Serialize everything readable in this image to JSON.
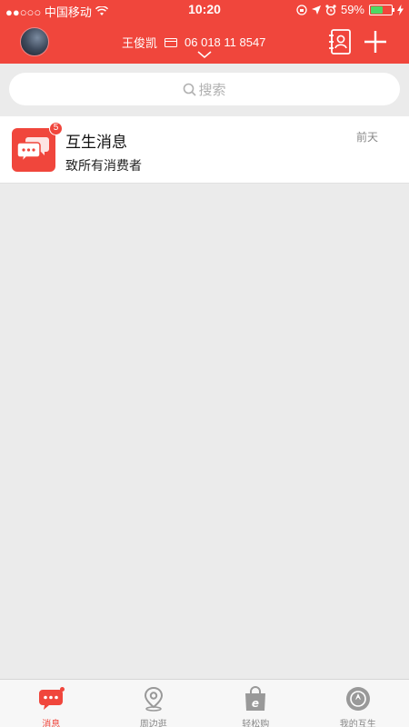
{
  "status_bar": {
    "carrier": "●●○○○ 中国移动",
    "time": "10:20",
    "battery_percent": "59%",
    "icons": [
      "wifi-icon",
      "location-arrow-icon",
      "alarm-icon",
      "battery-icon",
      "charging-icon"
    ]
  },
  "header": {
    "user_name": "王俊凯",
    "account_number": "06 018 11 8547",
    "icons": [
      "avatar",
      "card-icon",
      "chevron-down-icon",
      "contacts-icon",
      "plus-icon"
    ]
  },
  "search": {
    "placeholder": "搜索",
    "icon": "search-icon"
  },
  "messages": [
    {
      "title": "互生消息",
      "subtitle": "致所有消费者",
      "time": "前天",
      "badge": "5",
      "icon": "chat-bubbles-icon"
    }
  ],
  "tabbar": {
    "items": [
      {
        "label": "消息",
        "icon": "chat-icon",
        "active": true
      },
      {
        "label": "周边逛",
        "icon": "map-pin-icon",
        "active": false
      },
      {
        "label": "轻松购",
        "icon": "shopping-bag-icon",
        "active": false
      },
      {
        "label": "我的互生",
        "icon": "profile-icon",
        "active": false
      }
    ]
  },
  "colors": {
    "brand_red": "#f0463c",
    "background": "#ebebeb",
    "battery_green": "#4cd964"
  }
}
